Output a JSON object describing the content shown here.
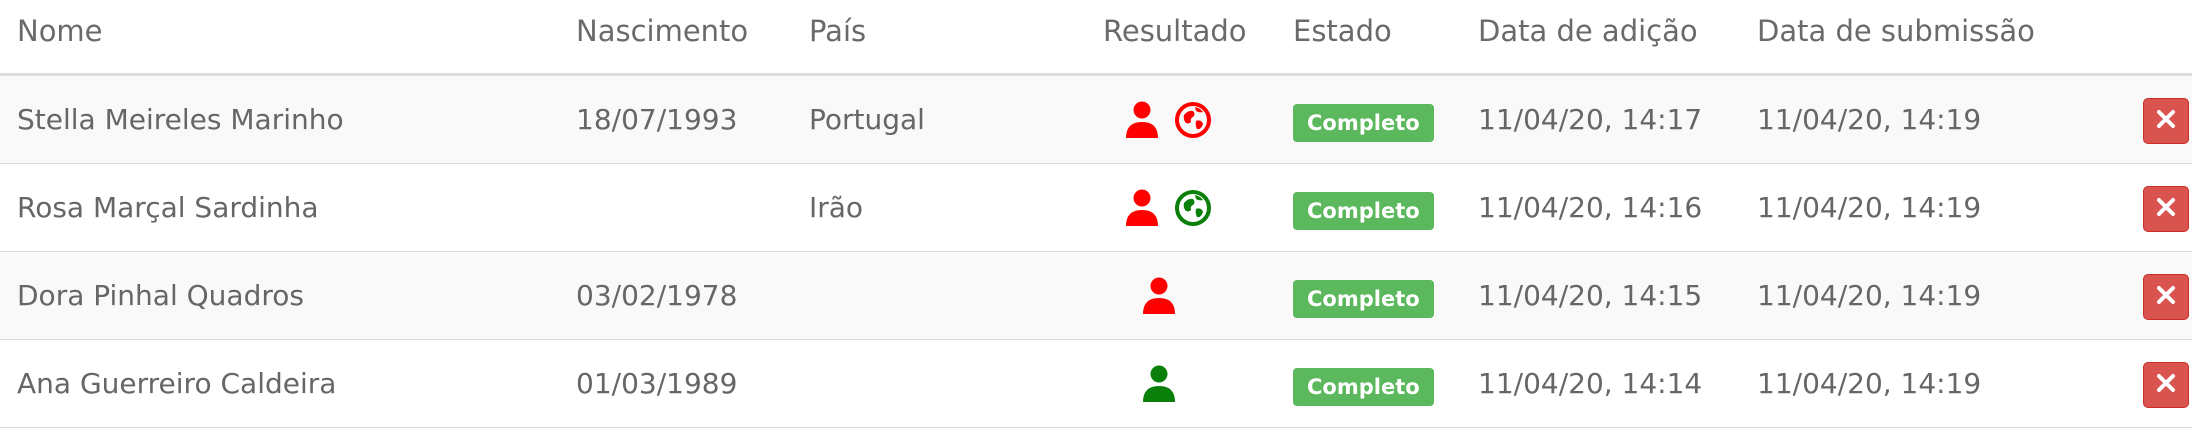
{
  "colors": {
    "person_red": "#ff0000",
    "person_green": "#0a7f0a",
    "globe_red": "#ff0000",
    "globe_green": "#0a7f0a",
    "badge_green": "#5cb85c",
    "delete_red": "#d9534f"
  },
  "header": {
    "nome": "Nome",
    "nascimento": "Nascimento",
    "pais": "País",
    "resultado": "Resultado",
    "estado": "Estado",
    "data_adicao": "Data de adição",
    "data_submissao": "Data de submissão"
  },
  "rows": [
    {
      "nome": "Stella Meireles Marinho",
      "nascimento": "18/07/1993",
      "pais": "Portugal",
      "resultado_icons": [
        "person-icon-red",
        "globe-icon-red"
      ],
      "estado": "Completo",
      "data_adicao": "11/04/20, 14:17",
      "data_submissao": "11/04/20, 14:19",
      "delete_icon": "close-icon"
    },
    {
      "nome": "Rosa Marçal Sardinha",
      "nascimento": "",
      "pais": "Irão",
      "resultado_icons": [
        "person-icon-red",
        "globe-icon-green"
      ],
      "estado": "Completo",
      "data_adicao": "11/04/20, 14:16",
      "data_submissao": "11/04/20, 14:19",
      "delete_icon": "close-icon"
    },
    {
      "nome": "Dora Pinhal Quadros",
      "nascimento": "03/02/1978",
      "pais": "",
      "resultado_icons": [
        "person-icon-red"
      ],
      "estado": "Completo",
      "data_adicao": "11/04/20, 14:15",
      "data_submissao": "11/04/20, 14:19",
      "delete_icon": "close-icon"
    },
    {
      "nome": "Ana Guerreiro Caldeira",
      "nascimento": "01/03/1989",
      "pais": "",
      "resultado_icons": [
        "person-icon-green"
      ],
      "estado": "Completo",
      "data_adicao": "11/04/20, 14:14",
      "data_submissao": "11/04/20, 14:19",
      "delete_icon": "close-icon"
    }
  ]
}
